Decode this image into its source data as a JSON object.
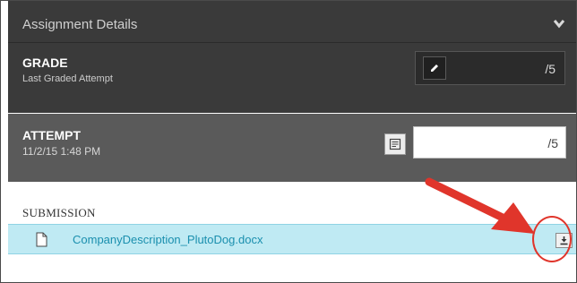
{
  "header": {
    "title": "Assignment Details",
    "collapse_icon": "chevron-down-icon"
  },
  "grade": {
    "title": "GRADE",
    "subtitle": "Last Graded Attempt",
    "edit_icon": "pencil-icon",
    "out_of": "/5"
  },
  "attempt": {
    "title": "ATTEMPT",
    "date": "11/2/15 1:48 PM",
    "feedback_icon": "feedback-icon",
    "out_of": "/5"
  },
  "submission": {
    "label": "SUBMISSION",
    "file_icon": "document-icon",
    "file_name": "CompanyDescription_PlutoDog.docx",
    "download_icon": "download-icon"
  },
  "annotation": {
    "arrow_color": "#e0352b",
    "circle_color": "#e0352b"
  },
  "colors": {
    "header_bg": "#3a3a3a",
    "attempt_bg": "#5a5a5a",
    "file_row_bg": "#bfeaf3",
    "link": "#1a8fae"
  }
}
